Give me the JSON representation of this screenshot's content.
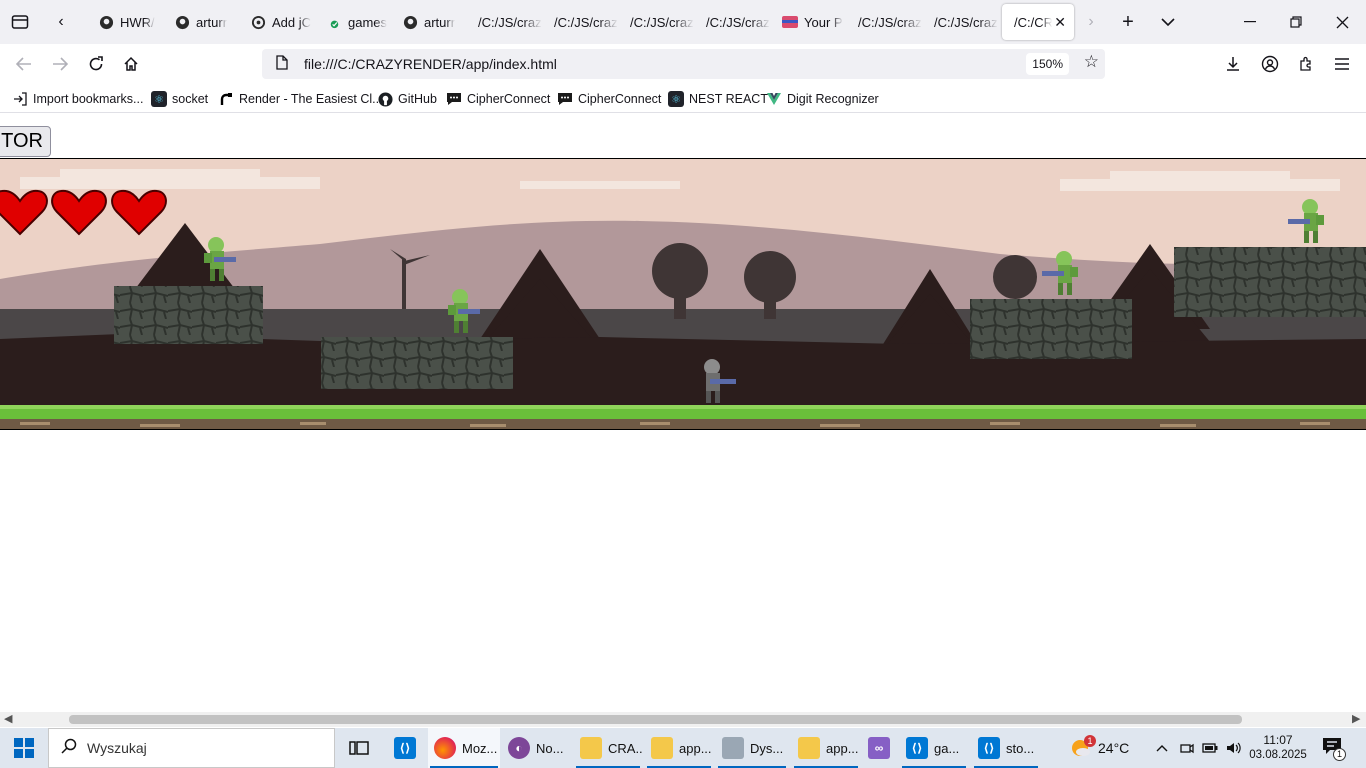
{
  "tabs": [
    {
      "label": "HWR/",
      "icon": "github-icon"
    },
    {
      "label": "arturr",
      "icon": "github-icon"
    },
    {
      "label": "Add jC",
      "icon": "openai-icon"
    },
    {
      "label": "games",
      "icon": "game-favicon"
    },
    {
      "label": "arturr",
      "icon": "github-icon"
    },
    {
      "label": "/C:/JS/craz",
      "icon": ""
    },
    {
      "label": "/C:/JS/craz",
      "icon": ""
    },
    {
      "label": "/C:/JS/craz",
      "icon": ""
    },
    {
      "label": "/C:/JS/craz",
      "icon": ""
    },
    {
      "label": "Your P",
      "icon": "card-favicon"
    },
    {
      "label": "/C:/JS/craz",
      "icon": ""
    },
    {
      "label": "/C:/JS/craz",
      "icon": ""
    },
    {
      "label": "/C:/CRA",
      "icon": "",
      "active": true
    }
  ],
  "nav": {
    "url": "file:///C:/CRAZYRENDER/app/index.html",
    "zoom": "150%"
  },
  "bookmarks": [
    {
      "label": "Import bookmarks...",
      "icon": "import-icon"
    },
    {
      "label": "socket",
      "icon": "react-icon"
    },
    {
      "label": "Render - The Easiest Cl...",
      "icon": "render-icon"
    },
    {
      "label": "GitHub",
      "icon": "github-icon"
    },
    {
      "label": "CipherConnect",
      "icon": "chat-icon"
    },
    {
      "label": "CipherConnect",
      "icon": "chat-icon"
    },
    {
      "label": "NEST REACT",
      "icon": "react-icon"
    },
    {
      "label": "Digit Recognizer",
      "icon": "vue-icon"
    }
  ],
  "page": {
    "editor_button": "ITOR"
  },
  "game": {
    "lives": 3,
    "colors": {
      "sky": "#ecd2c6",
      "mountain": "#b2989a",
      "ground_dark": "#2b1d1c",
      "grass": "#6abf3a",
      "stone": "#4a5049"
    }
  },
  "taskbar": {
    "search_placeholder": "Wyszukaj",
    "apps": [
      {
        "label": "",
        "icon": "task-view-icon"
      },
      {
        "label": "",
        "icon": "vscode-icon"
      },
      {
        "label": "Moz...",
        "icon": "firefox-icon"
      },
      {
        "label": "No...",
        "icon": "tor-icon"
      },
      {
        "label": "CRA...",
        "icon": "folder-icon"
      },
      {
        "label": "app...",
        "icon": "folder-icon"
      },
      {
        "label": "Dys...",
        "icon": "disk-icon"
      },
      {
        "label": "app...",
        "icon": "folder-icon"
      },
      {
        "label": "",
        "icon": "visual-studio-icon"
      },
      {
        "label": "ga...",
        "icon": "vscode-icon"
      },
      {
        "label": "sto...",
        "icon": "vscode-icon"
      }
    ],
    "weather": "24°C",
    "weather_badge": "1",
    "time": "11:07",
    "date": "03.08.2025",
    "notification_count": "1"
  }
}
